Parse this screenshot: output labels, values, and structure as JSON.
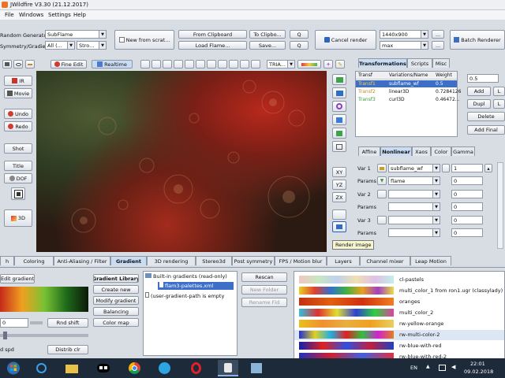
{
  "window": {
    "title": "JWildfire V3.30 (21.12.2017)"
  },
  "menu": [
    "File",
    "Windows",
    "Settings",
    "Help"
  ],
  "toolbar": {
    "random_generator_label": "Random Generator",
    "random_generator_value": "SubFlame",
    "symmetry_label": "Symmetry/Gradient",
    "symmetry_value": "All (...",
    "stroke_value": "Stro...",
    "new_from_scratch": "New from scrat...",
    "from_clipboard": "From Clipboard",
    "to_clipboard": "To Clipbo...",
    "load_flame": "Load Flame...",
    "save": "Save...",
    "q1": "Q",
    "q2": "Q",
    "cancel_render": "Cancel render",
    "resolution": "1440x900",
    "quality": "max",
    "more1": "...",
    "more2": "...",
    "batch_renderer": "Batch Renderer"
  },
  "preview_toolbar": {
    "fine_edit": "Fine Edit",
    "realtime": "Realtime",
    "triangle_mode": "TRIA..."
  },
  "left_tools": [
    "IR",
    "Movie",
    "Undo",
    "Redo",
    "Shot",
    "Title",
    "DOF",
    "3D"
  ],
  "right_tools": [
    "XY",
    "YZ",
    "ZX"
  ],
  "tooltip": "Render image",
  "transforms": {
    "tabs": [
      "Transformations",
      "Scripts",
      "Misc"
    ],
    "columns": [
      "Transf",
      "Variations/Name",
      "Weight"
    ],
    "rows": [
      {
        "name": "Transf1",
        "variations": "subflame_wf",
        "weight": "0.5"
      },
      {
        "name": "Transf2",
        "variations": "linear3D",
        "weight": "0.7284126"
      },
      {
        "name": "Transf3",
        "variations": "curl3D",
        "weight": "0.46472..."
      }
    ],
    "weight_field": "0.5",
    "add": "Add",
    "dupl": "Dupl",
    "delete": "Delete",
    "add_final": "Add Final",
    "l1": "L",
    "l2": "L"
  },
  "vars_tabs": [
    "Affine",
    "Nonlinear",
    "Xaos",
    "Color",
    "Gamma"
  ],
  "vars": [
    {
      "label": "Var 1",
      "variation": "subflame_wf",
      "value": "1",
      "params_label": "Params",
      "param": "flame",
      "param_value": "0"
    },
    {
      "label": "Var 2",
      "variation": "",
      "value": "0",
      "params_label": "Params",
      "param": "",
      "param_value": "0"
    },
    {
      "label": "Var 3",
      "variation": "",
      "value": "0",
      "params_label": "Params",
      "param": "",
      "param_value": "0"
    }
  ],
  "bottom_tabs": [
    "h",
    "Coloring",
    "Anti-Aliasing / Filter",
    "Gradient",
    "3D rendering",
    "Stereo3d",
    "Post symmetry",
    "FPS / Motion blur",
    "Layers",
    "Channel mixer",
    "Leap Motion"
  ],
  "gradient": {
    "edit_gradient": "Edit gradient",
    "shift_value": "0",
    "rnd_shift": "Rnd shift",
    "distrib_clr": "Distrib clr",
    "spd": "d spd",
    "library_buttons": [
      "Gradient Library",
      "Create new",
      "Modify gradient",
      "Balancing",
      "Color map"
    ],
    "tree": [
      "Built-in gradients (read-only)",
      "flam3-palettes.xml",
      "(user-gradient-path is empty"
    ],
    "rescan": "Rescan",
    "new_folder": "New Folder",
    "rename_fld": "Rename Fld",
    "list": [
      "cl-pastels",
      "multi_color_1 from ron1.ugr (classylady)",
      "oranges",
      "multi_color_2",
      "rw-yellow-orange",
      "rw-multi-color-2",
      "rw-blue-with-red",
      "rw-blue-with-red-2"
    ]
  },
  "taskbar": {
    "lang": "EN",
    "time": "22:01",
    "date": "09.02.2018"
  }
}
